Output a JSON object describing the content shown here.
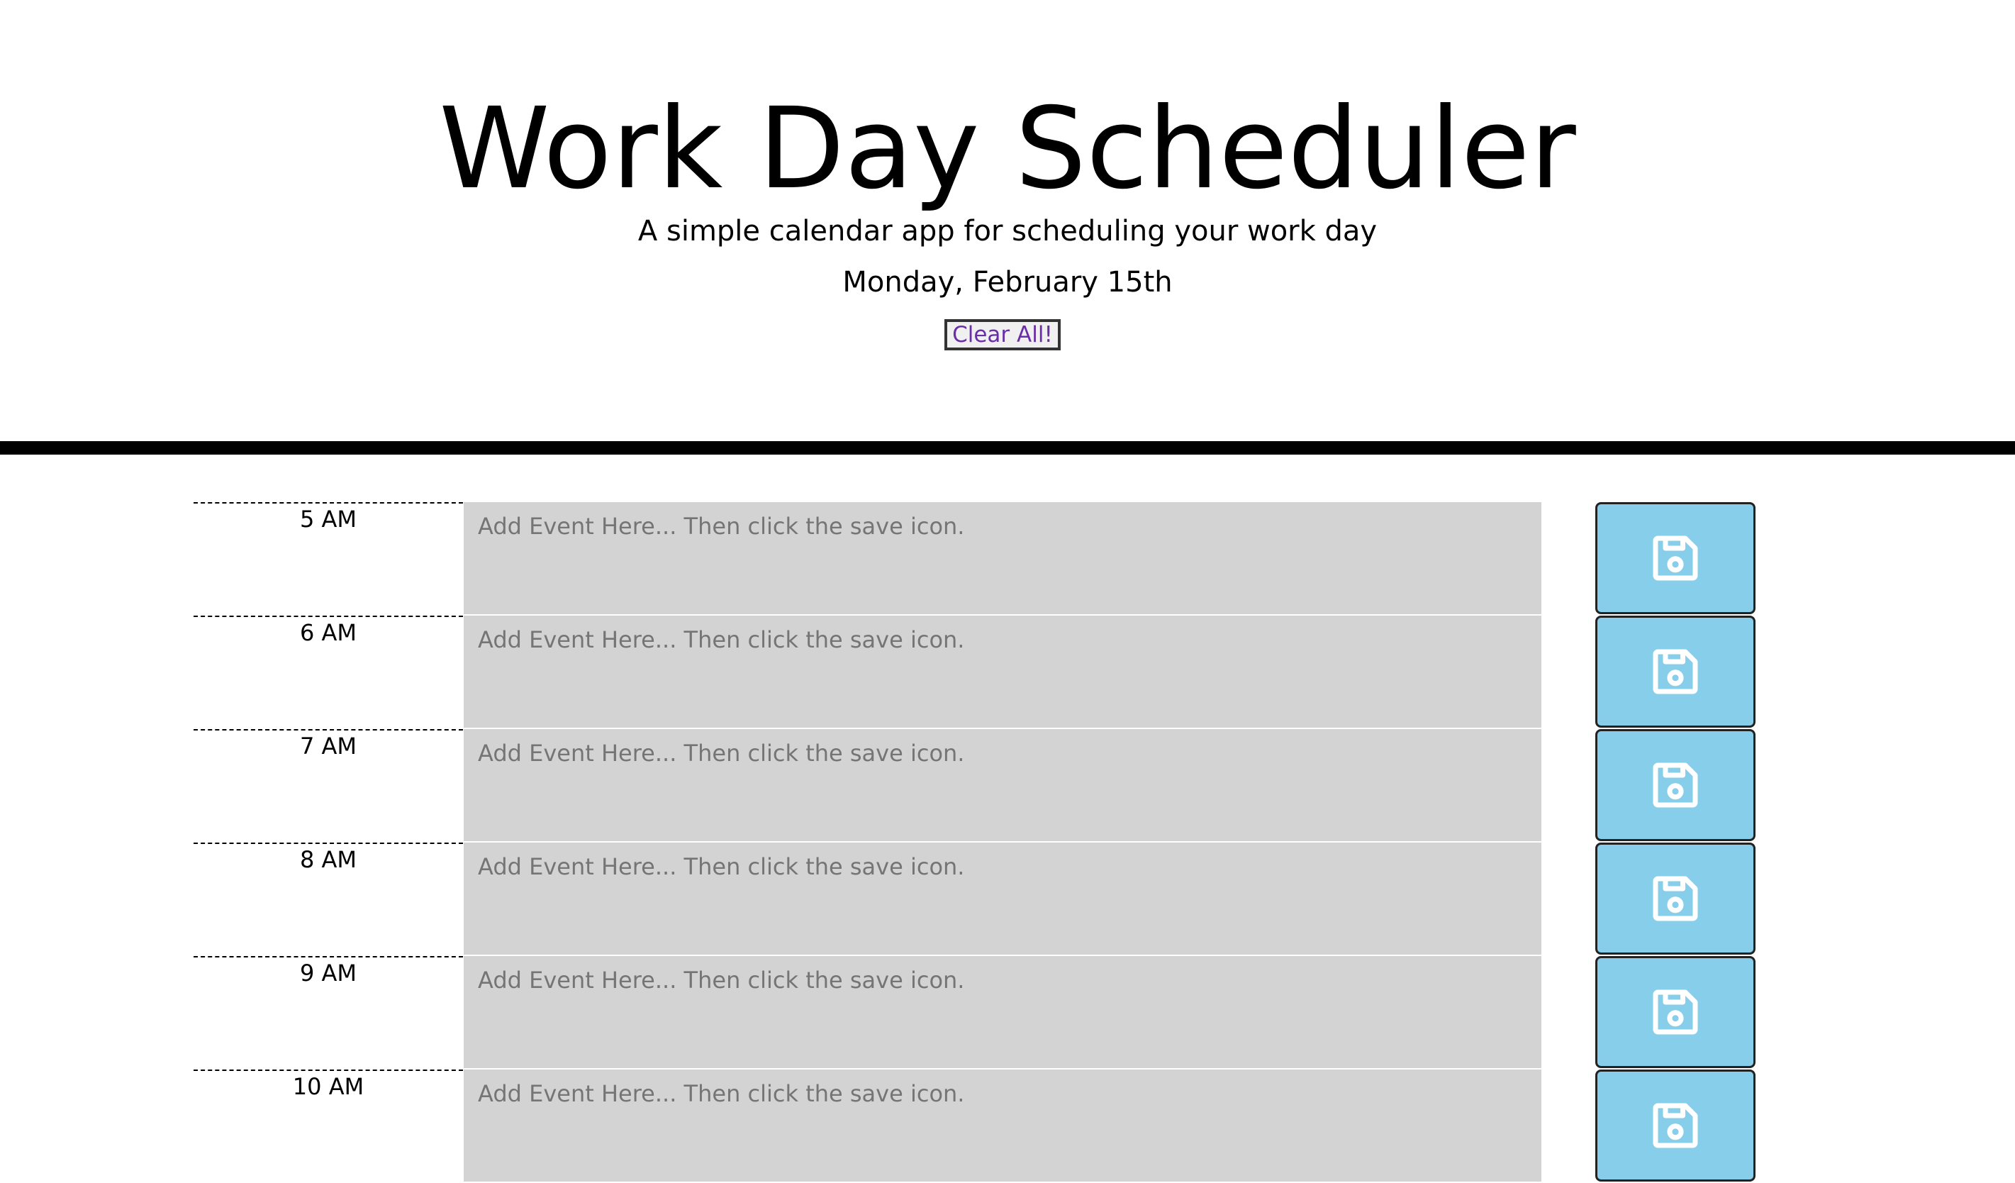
{
  "header": {
    "title": "Work Day Scheduler",
    "subtitle": "A simple calendar app for scheduling your work day",
    "current_day": "Monday, February 15th",
    "clear_label": "Clear All!"
  },
  "colors": {
    "save_button": "#87ceeb",
    "event_background": "#d3d3d3",
    "clear_text": "#6a2fa8"
  },
  "time_blocks": [
    {
      "hour": "5 AM",
      "placeholder": "Add Event Here... Then click the save icon.",
      "value": "",
      "save_icon": "save-icon"
    },
    {
      "hour": "6 AM",
      "placeholder": "Add Event Here... Then click the save icon.",
      "value": "",
      "save_icon": "save-icon"
    },
    {
      "hour": "7 AM",
      "placeholder": "Add Event Here... Then click the save icon.",
      "value": "",
      "save_icon": "save-icon"
    },
    {
      "hour": "8 AM",
      "placeholder": "Add Event Here... Then click the save icon.",
      "value": "",
      "save_icon": "save-icon"
    },
    {
      "hour": "9 AM",
      "placeholder": "Add Event Here... Then click the save icon.",
      "value": "",
      "save_icon": "save-icon"
    },
    {
      "hour": "10 AM",
      "placeholder": "Add Event Here... Then click the save icon.",
      "value": "",
      "save_icon": "save-icon"
    }
  ]
}
